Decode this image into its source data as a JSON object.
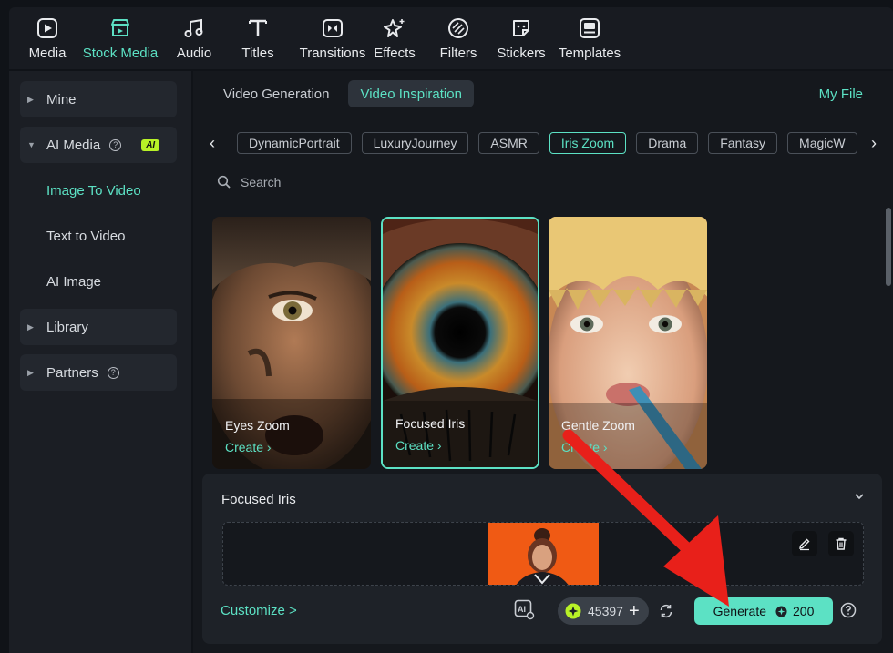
{
  "toolbar": {
    "items": [
      {
        "label": "Media",
        "icon": "media-icon"
      },
      {
        "label": "Stock Media",
        "icon": "stock-media-icon",
        "active": true
      },
      {
        "label": "Audio",
        "icon": "music-note-icon"
      },
      {
        "label": "Titles",
        "icon": "text-t-icon"
      },
      {
        "label": "Transitions",
        "icon": "transition-icon"
      },
      {
        "label": "Effects",
        "icon": "sparkle-icon"
      },
      {
        "label": "Filters",
        "icon": "filter-icon"
      },
      {
        "label": "Stickers",
        "icon": "sticker-icon"
      },
      {
        "label": "Templates",
        "icon": "template-icon"
      }
    ]
  },
  "sidebar": {
    "mine": "Mine",
    "ai_media": "AI Media",
    "ai_badge": "AI",
    "image_to_video": "Image To Video",
    "text_to_video": "Text to Video",
    "ai_image": "AI Image",
    "library": "Library",
    "partners": "Partners",
    "help_glyph": "?"
  },
  "main": {
    "tabs": [
      "Video Generation",
      "Video Inspiration"
    ],
    "active_tab": "Video Inspiration",
    "my_file": "My File",
    "categories": [
      "DynamicPortrait",
      "LuxuryJourney",
      "ASMR",
      "Iris Zoom",
      "Drama",
      "Fantasy",
      "MagicW"
    ],
    "active_category": "Iris Zoom",
    "search_placeholder": "Search",
    "cards": [
      {
        "title": "Eyes Zoom",
        "action": "Create"
      },
      {
        "title": "Focused Iris",
        "action": "Create",
        "selected": true
      },
      {
        "title": "Gentle Zoom",
        "action": "Create"
      }
    ]
  },
  "generate_panel": {
    "title": "Focused Iris",
    "customize": "Customize >",
    "credits": "45397",
    "generate_label": "Generate",
    "generate_cost": "200"
  },
  "colors": {
    "accent": "#5ce1c4",
    "ai_badge": "#b8f227",
    "annotation_arrow": "#e8201a",
    "thumb_bg": "#f05a14"
  }
}
